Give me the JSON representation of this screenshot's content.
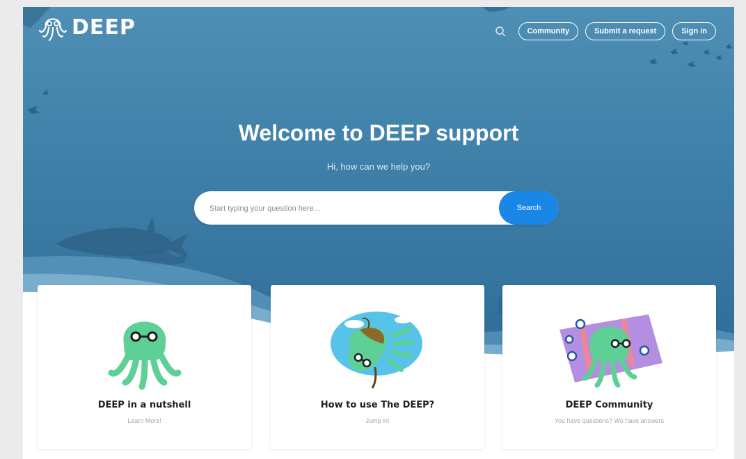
{
  "brand": {
    "name": "DEEP"
  },
  "nav": {
    "community_label": "Community",
    "submit_request_label": "Submit a request",
    "sign_in_label": "Sign in"
  },
  "hero": {
    "title": "Welcome to DEEP support",
    "subtitle": "Hi, how can we help you?",
    "search": {
      "placeholder": "Start typing your question here...",
      "button_label": "Search"
    }
  },
  "cards": [
    {
      "title": "DEEP in a nutshell",
      "subtitle": "Learn More!",
      "illustration": "octopus-icon"
    },
    {
      "title": "How to use The DEEP?",
      "subtitle": "Jump in!",
      "illustration": "octopus-diving-icon"
    },
    {
      "title": "DEEP Community",
      "subtitle": "You have questions? We have answers",
      "illustration": "octopus-community-icon"
    }
  ],
  "colors": {
    "hero": "#3e7fa8",
    "search_button": "#1a87e6",
    "octopus": "#5ecf95",
    "card_title": "#1f1f1f"
  }
}
